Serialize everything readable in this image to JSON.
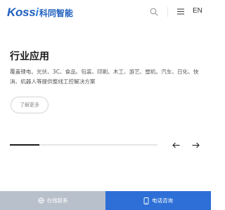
{
  "header": {
    "logo_latin_main": "Koss",
    "logo_latin_accent": "i",
    "logo_cn": "科同智能",
    "lang_label": "EN",
    "icons": {
      "search": "search-icon",
      "menu": "menu-icon"
    }
  },
  "section": {
    "title": "行业应用",
    "description": "覆盖锂电、光伏、3C、食品、包装、印刷、木工、游艺、塑机、汽车、日化、快消、机器人等提供整线工控解决方案",
    "more_label": "了解更多"
  },
  "carousel": {
    "progress_percent": 20,
    "prev_icon": "arrow-left-icon",
    "next_icon": "arrow-right-icon"
  },
  "bottom_bar": {
    "online_label": "在线联系",
    "phone_label": "电话咨询",
    "online_icon": "globe-icon",
    "phone_icon": "phone-icon"
  },
  "colors": {
    "brand": "#1d5fbf",
    "online_bg": "#b8c0cb",
    "phone_bg": "#2d6fd6",
    "progress": "#1a1a1a"
  }
}
